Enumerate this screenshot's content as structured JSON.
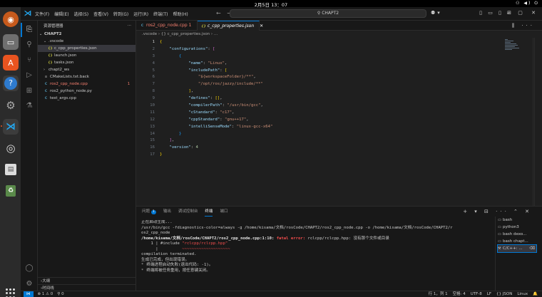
{
  "topbar": {
    "clock": "2月5日 13：07",
    "tray": "⚇ ◀) ⏻"
  },
  "dock": {
    "tooltip": "帮助"
  },
  "titlebar": {
    "menus": [
      "文件(F)",
      "编辑(E)",
      "选择(S)",
      "查看(V)",
      "转到(G)",
      "运行(R)",
      "终端(T)",
      "帮助(H)"
    ],
    "search": "CHAPT2"
  },
  "explorer": {
    "title": "资源管理器",
    "more": "···",
    "root": "CHAPT2",
    "items": [
      {
        "name": ".vscode",
        "kind": "folder-open",
        "indent": 1
      },
      {
        "name": "c_cpp_properties.json",
        "kind": "json",
        "indent": 2,
        "selected": true
      },
      {
        "name": "launch.json",
        "kind": "json",
        "indent": 2
      },
      {
        "name": "tasks.json",
        "kind": "json",
        "indent": 2
      },
      {
        "name": "chapt2_ws",
        "kind": "folder",
        "indent": 1
      },
      {
        "name": "CMakeLists.txt.back",
        "kind": "txt",
        "indent": 1
      },
      {
        "name": "ros2_cpp_node.cpp",
        "kind": "cpp",
        "indent": 1,
        "error": true,
        "badge": "1"
      },
      {
        "name": "ros2_python_node.py",
        "kind": "cpp",
        "indent": 1
      },
      {
        "name": "test_args.cpp",
        "kind": "cpp",
        "indent": 1
      }
    ],
    "outline": "大纲",
    "timeline": "时间线"
  },
  "tabs": [
    {
      "label": "ros2_cpp_node.cpp 1"
    },
    {
      "label": "c_cpp_properties.json"
    }
  ],
  "breadcrumb": ".vscode › {} c_cpp_properties.json › ...",
  "editor": {
    "line_numbers": [
      "1",
      "2",
      "3",
      "4",
      "5",
      "6",
      "7",
      "8",
      "9",
      "10",
      "11",
      "12",
      "13",
      "14",
      "15",
      "16",
      "17"
    ],
    "current_line": "1"
  },
  "panel": {
    "tabs": [
      "问题",
      "输出",
      "调试控制台",
      "终端",
      "端口"
    ],
    "problems_badge": "1",
    "active_tab": "终端",
    "terminal_lines": [
      "正在启动生成...",
      "/usr/bin/gcc -fdiagnostics-color=always -g /home/kisama/文档/rosCode/CHAPT2/ros2_cpp_node.cpp -o /home/kisama/文档/rosCode/CHAPT2/r",
      "os2_cpp_node",
      "compilation terminated.",
      "",
      "生成已完成，但出现错误。",
      "",
      " 终端进程启动失败(退出代码: -1)。",
      " 终端将被任务重用，按任意键关闭。"
    ],
    "error_line": {
      "path": "/home/kisama/文档/rosCode/CHAPT2/ros2_cpp_node.cpp:1:10:",
      "label": "fatal error:",
      "message": " rclcpp/rclcpp.hpp: 没有那个文件或目录"
    },
    "include_line": {
      "number": "1",
      "code": "#include ",
      "target": "\"rclcpp/rclcpp.hpp\""
    },
    "caret": "|",
    "tilde": "~~~~~~~~~~~~~~~~~~~~",
    "terminals": [
      {
        "label": "bash"
      },
      {
        "label": "python3"
      },
      {
        "label": "bash dexo..."
      },
      {
        "label": "bash chapt..."
      },
      {
        "label": "C/C++: ..."
      }
    ]
  },
  "statusbar": {
    "left": [
      "⊗ 1 ⚠ 0",
      "⚲ 0"
    ],
    "right": [
      "行 1，列 1",
      "空格: 4",
      "UTF-8",
      "LF",
      "{} JSON",
      "Linux",
      "🔔"
    ]
  }
}
